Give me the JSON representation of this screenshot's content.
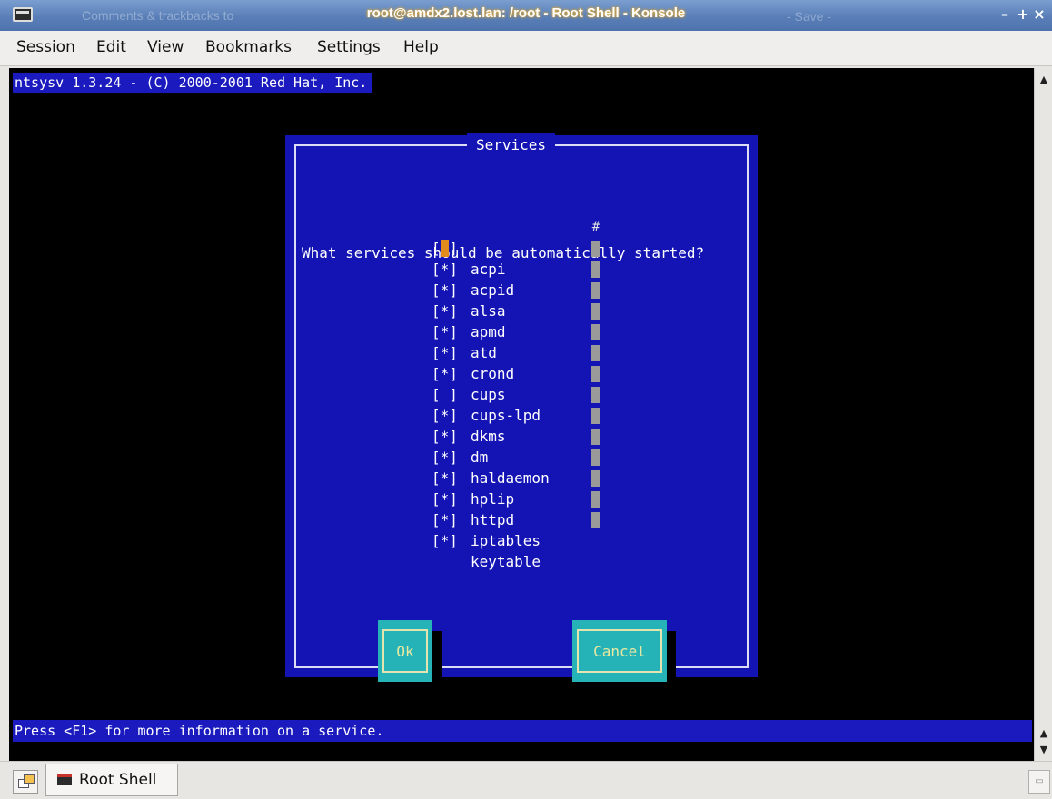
{
  "window": {
    "title": "root@amdx2.lost.lan: /root - Root Shell - Konsole",
    "ghost_left": "Comments & trackbacks to",
    "ghost_right": "- Save -",
    "controls": {
      "minimize": "–",
      "maximize": "+",
      "close": "×"
    }
  },
  "menubar": {
    "items": [
      "Session",
      "Edit",
      "View",
      "Bookmarks",
      "Settings",
      "Help"
    ]
  },
  "terminal": {
    "header": "ntsysv 1.3.24 - (C) 2000-2001 Red Hat, Inc.",
    "status": "Press <F1> for more information on a service."
  },
  "dialog": {
    "title": "Services",
    "prompt": "What services should be automatically started?",
    "services": [
      {
        "checkbox": "[*]",
        "name": "acpi",
        "focused": true
      },
      {
        "checkbox": "[*]",
        "name": "acpid"
      },
      {
        "checkbox": "[*]",
        "name": "alsa"
      },
      {
        "checkbox": "[*]",
        "name": "apmd"
      },
      {
        "checkbox": "[*]",
        "name": "atd"
      },
      {
        "checkbox": "[*]",
        "name": "crond"
      },
      {
        "checkbox": "[*]",
        "name": "cups"
      },
      {
        "checkbox": "[ ]",
        "name": "cups-lpd"
      },
      {
        "checkbox": "[*]",
        "name": "dkms"
      },
      {
        "checkbox": "[*]",
        "name": "dm"
      },
      {
        "checkbox": "[*]",
        "name": "haldaemon"
      },
      {
        "checkbox": "[*]",
        "name": "hplip"
      },
      {
        "checkbox": "[*]",
        "name": "httpd"
      },
      {
        "checkbox": "[*]",
        "name": "iptables"
      },
      {
        "checkbox": "[*]",
        "name": "keytable"
      }
    ],
    "scroll_thumb": "#",
    "ok_label": "Ok",
    "cancel_label": "Cancel"
  },
  "tabs": [
    {
      "label": "Root Shell",
      "icon": "terminal-icon"
    }
  ],
  "colors": {
    "terminal_bg": "#000000",
    "dialog_bg": "#1414b4",
    "button_bg": "#25b3b8",
    "focus_cursor": "#e28c1e"
  }
}
